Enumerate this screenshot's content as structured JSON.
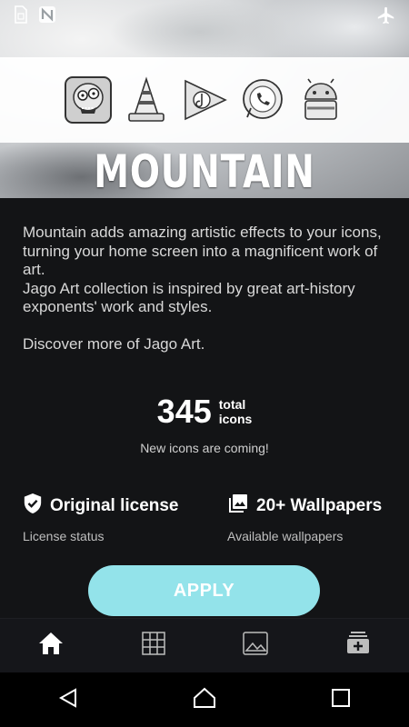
{
  "status_bar": {
    "icons": [
      "sim-card-icon",
      "nfc-n-icon",
      "airplane-mode-icon"
    ]
  },
  "header": {
    "title": "MOUNTAIN",
    "preview_icons": [
      "zombie-app-icon",
      "vlc-cone-app-icon",
      "play-music-app-icon",
      "whatsapp-app-icon",
      "android-app-icon"
    ]
  },
  "description": {
    "p1": "Mountain adds amazing artistic effects to your icons, turning your home screen into a magnificent work of art.",
    "p2": "Jago Art collection is inspired by great art-history exponents' work and styles.",
    "p3": "Discover more of Jago Art."
  },
  "icons_count": {
    "number": "345",
    "label_line1": "total",
    "label_line2": "icons",
    "note": "New icons are coming!"
  },
  "features": {
    "license": {
      "title": "Original license",
      "subtitle": "License status",
      "icon": "shield-check-icon"
    },
    "wallpapers": {
      "title": "20+ Wallpapers",
      "subtitle": "Available wallpapers",
      "icon": "photo-library-icon"
    }
  },
  "apply_button": {
    "label": "APPLY",
    "color": "#93e3ea"
  },
  "bottom_tabs": [
    "home-icon",
    "grid-icon",
    "image-icon",
    "request-icon"
  ],
  "nav_bar": [
    "back-icon",
    "home-nav-icon",
    "recents-icon"
  ]
}
